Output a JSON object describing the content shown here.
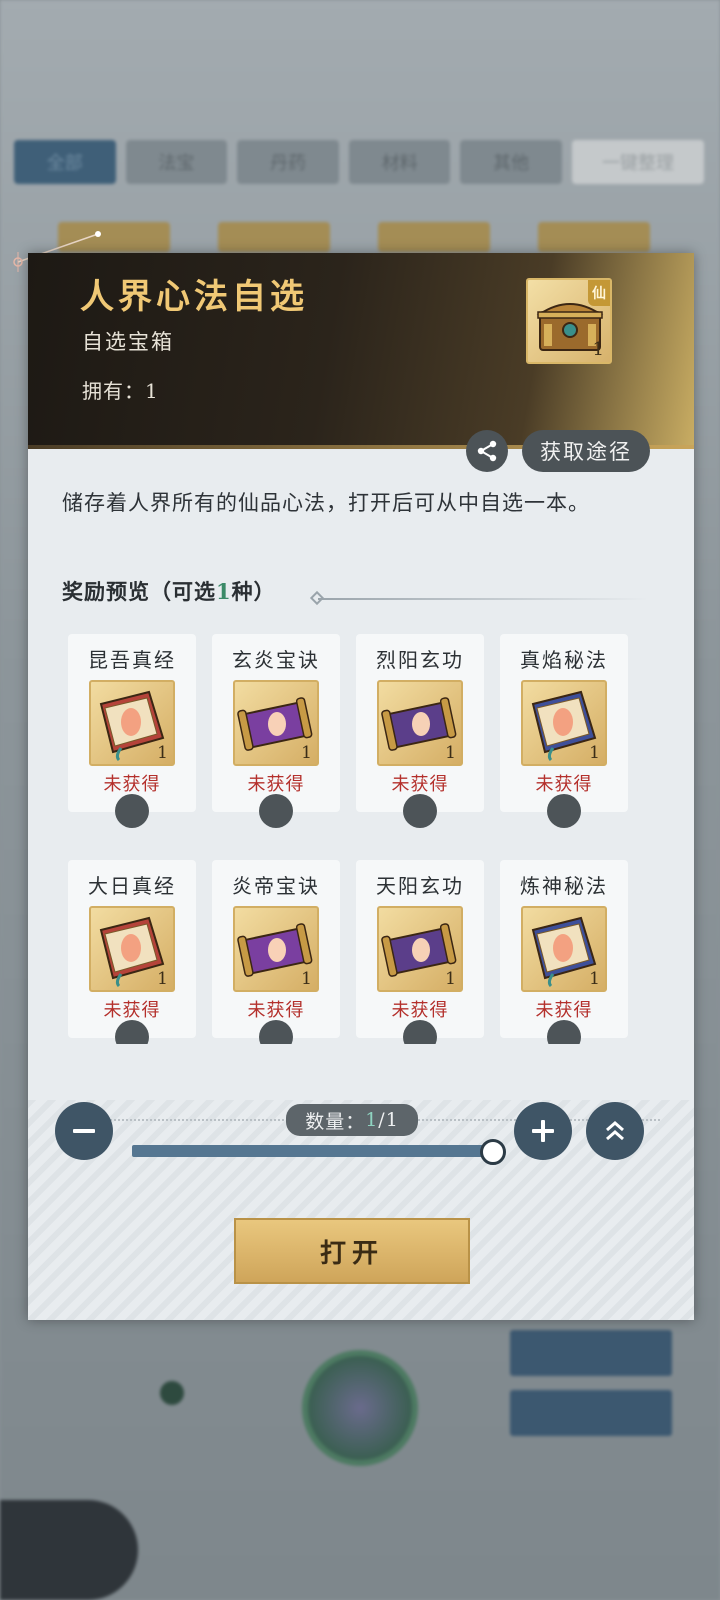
{
  "background": {
    "tabs": [
      "全部",
      "法宝",
      "丹药",
      "材料",
      "其他",
      "一键整理"
    ]
  },
  "item": {
    "title": "人界心法自选",
    "category": "自选宝箱",
    "owned_label": "拥有：1",
    "badge": "仙",
    "icon_count": "1",
    "share_icon": "share-icon",
    "route_button": "获取途径"
  },
  "description": "储存着人界所有的仙品心法，打开后可从中自选一本。",
  "preview": {
    "title_prefix": "奖励预览（可选",
    "title_count": "1",
    "title_suffix": "种）"
  },
  "rewards": [
    {
      "name": "昆吾真经",
      "qty": "1",
      "status": "未获得",
      "color": "#b5433a",
      "icon": "book-icon"
    },
    {
      "name": "玄炎宝诀",
      "qty": "1",
      "status": "未获得",
      "color": "#7a3fa0",
      "icon": "scroll-icon"
    },
    {
      "name": "烈阳玄功",
      "qty": "1",
      "status": "未获得",
      "color": "#5b3e8a",
      "icon": "scroll-icon"
    },
    {
      "name": "真焰秘法",
      "qty": "1",
      "status": "未获得",
      "color": "#3e4f9a",
      "icon": "book-icon"
    },
    {
      "name": "大日真经",
      "qty": "1",
      "status": "未获得",
      "color": "#b5433a",
      "icon": "book-icon"
    },
    {
      "name": "炎帝宝诀",
      "qty": "1",
      "status": "未获得",
      "color": "#7a3fa0",
      "icon": "scroll-icon"
    },
    {
      "name": "天阳玄功",
      "qty": "1",
      "status": "未获得",
      "color": "#5b3e8a",
      "icon": "scroll-icon"
    },
    {
      "name": "炼神秘法",
      "qty": "1",
      "status": "未获得",
      "color": "#3e4f9a",
      "icon": "book-icon"
    }
  ],
  "quantity": {
    "label": "数量：",
    "current": "1",
    "total": "/1",
    "slider_fraction": 1.0
  },
  "buttons": {
    "minus": "minus-icon",
    "plus": "plus-icon",
    "max": "double-chevron-up-icon",
    "open": "打开"
  }
}
